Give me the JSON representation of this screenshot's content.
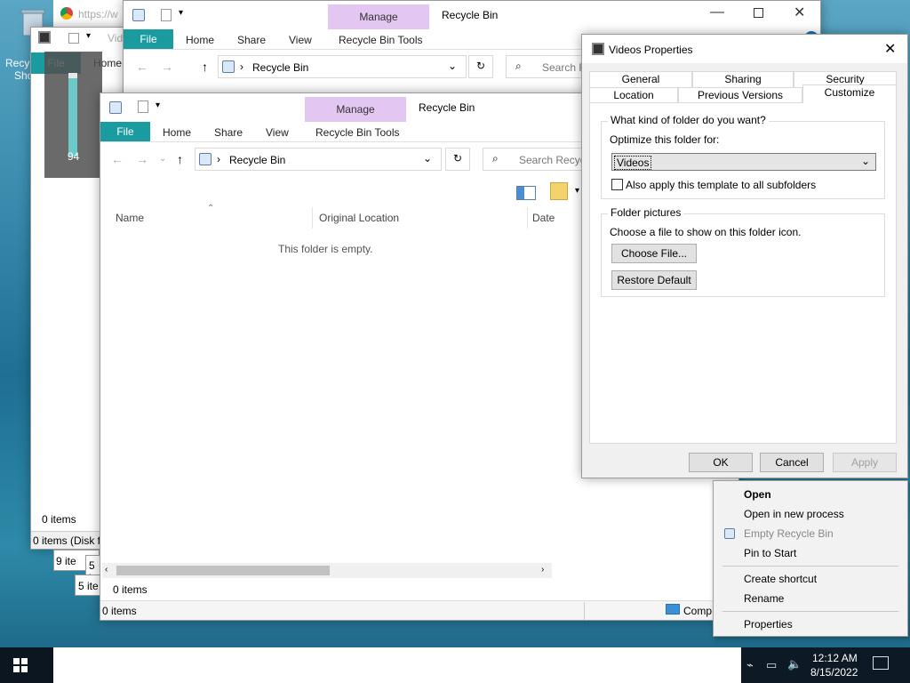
{
  "desktop": {
    "recycle_label": "Recyc",
    "recycle_label2": "Sho"
  },
  "bg_window_far": {
    "file_tab": "File",
    "home_tab": "Home",
    "title_partial": "Vid",
    "status_items": "0 items",
    "status_disk": "0 items (Disk f",
    "stack_label_1": "9 ite",
    "stack_label_2": "5 it",
    "stack_label_3": "5 ite"
  },
  "gauge": {
    "value": "94",
    "fill_percent": 0.94
  },
  "chrome_partial": {
    "url": "https://w"
  },
  "bg_window": {
    "title": "Recycle Bin",
    "manage": "Manage",
    "tools": "Recycle Bin Tools",
    "file": "File",
    "home": "Home",
    "share": "Share",
    "view": "View",
    "address": "Recycle Bin",
    "search_placeholder": "Search R"
  },
  "explorer": {
    "title": "Recycle Bin",
    "manage": "Manage",
    "tools": "Recycle Bin Tools",
    "tabs": {
      "file": "File",
      "home": "Home",
      "share": "Share",
      "view": "View"
    },
    "address": "Recycle Bin",
    "search_placeholder": "Search Recycl",
    "columns": {
      "name": "Name",
      "original_location": "Original Location",
      "date": "Date"
    },
    "empty_message": "This folder is empty.",
    "inner_status": "0 items",
    "status": "0 items",
    "computer_label": "Comp"
  },
  "dialog": {
    "title": "Videos Properties",
    "tabs_row1": [
      "General",
      "Sharing",
      "Security"
    ],
    "tabs_row2": [
      "Location",
      "Previous Versions",
      "Customize"
    ],
    "group1_title": "What kind of folder do you want?",
    "optimize_label": "Optimize this folder for:",
    "optimize_value": "Videos",
    "apply_subfolders": "Also apply this template to all subfolders",
    "group2_title": "Folder pictures",
    "choose_label": "Choose a file to show on this folder icon.",
    "choose_button": "Choose File...",
    "restore_button": "Restore Default",
    "ok": "OK",
    "cancel": "Cancel",
    "apply": "Apply"
  },
  "context_menu": {
    "items": [
      "Open",
      "Open in new process",
      "Empty Recycle Bin",
      "Pin to Start",
      "Create shortcut",
      "Rename",
      "Properties"
    ]
  },
  "taskbar": {
    "time": "12:12 AM",
    "date": "8/15/2022"
  },
  "colors": {
    "accent": "#1a9ba0",
    "manage_bg": "#e4c6f2"
  }
}
